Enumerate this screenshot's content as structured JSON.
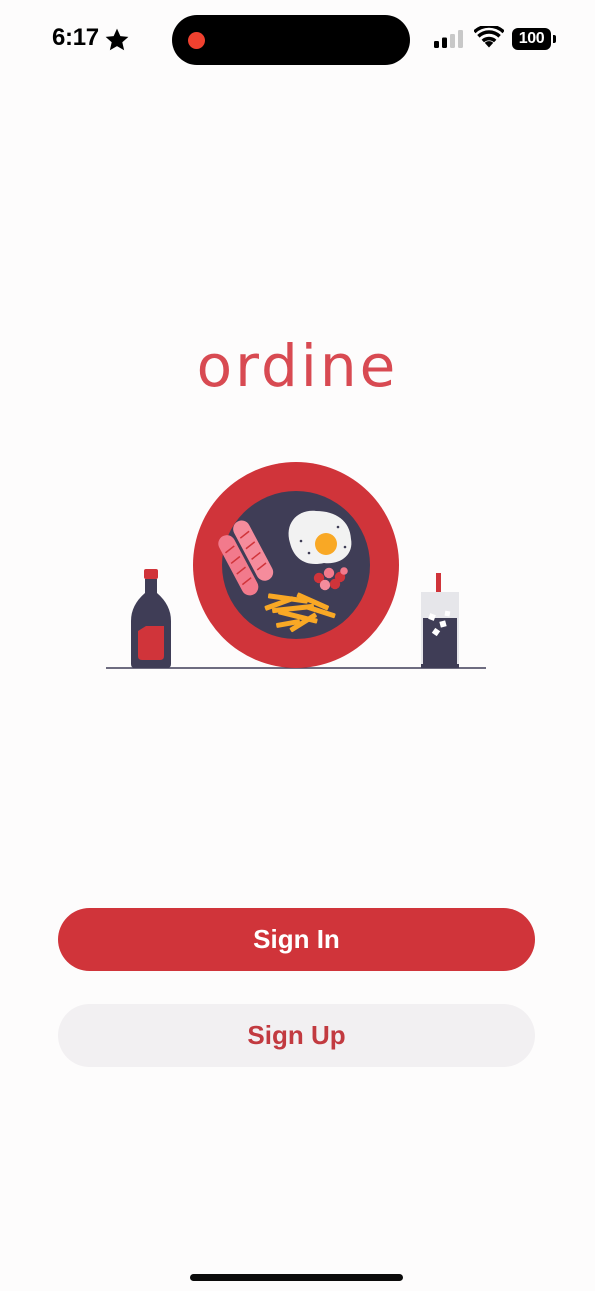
{
  "status_bar": {
    "time": "6:17",
    "battery": "100",
    "icons": [
      "star-icon",
      "recording-dot",
      "cellular-signal-icon",
      "wifi-icon",
      "battery-icon"
    ]
  },
  "brand": {
    "logo_text": "ordine",
    "logo_color": "#d84a52"
  },
  "illustration": {
    "name": "food-plate-illustration",
    "elements": [
      "ketchup-bottle",
      "plate-with-sausages-egg-fries-berries",
      "drink-glass-with-straw"
    ]
  },
  "actions": {
    "sign_in_label": "Sign In",
    "sign_up_label": "Sign Up"
  },
  "colors": {
    "primary": "#d0343a",
    "secondary_bg": "#f2f0f2",
    "secondary_text": "#c23a40",
    "plate_dark": "#3f3d56"
  }
}
